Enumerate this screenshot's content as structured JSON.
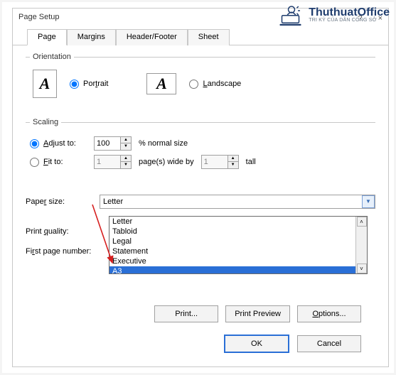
{
  "window": {
    "title": "Page Setup",
    "help": "?",
    "close": "×"
  },
  "tabs": {
    "page": "Page",
    "margins": "Margins",
    "headerfooter": "Header/Footer",
    "sheet": "Sheet"
  },
  "orientation": {
    "legend": "Orientation",
    "portrait": "Portrait",
    "landscape": "Landscape"
  },
  "scaling": {
    "legend": "Scaling",
    "adjust_label": "Adjust to:",
    "adjust_value": "100",
    "adjust_suffix": "% normal size",
    "fit_label": "Fit to:",
    "fit_wide_value": "1",
    "fit_mid": "page(s) wide by",
    "fit_tall_value": "1",
    "fit_tall": "tall"
  },
  "paper": {
    "label": "Paper size:",
    "value": "Letter",
    "options": {
      "o0": "Letter",
      "o1": "Tabloid",
      "o2": "Legal",
      "o3": "Statement",
      "o4": "Executive",
      "o5": "A3"
    }
  },
  "quality": {
    "label": "Print quality:"
  },
  "firstpage": {
    "label": "First page number:"
  },
  "buttons": {
    "print": "Print...",
    "preview": "Print Preview",
    "options": "Options...",
    "ok": "OK",
    "cancel": "Cancel"
  },
  "brand": {
    "name": "ThuthuatOffice",
    "sub": "TRI KỶ CỦA DÂN CÔNG SỞ"
  },
  "colors": {
    "accent": "#2a6fd6",
    "highlight": "#2a6fd6"
  }
}
